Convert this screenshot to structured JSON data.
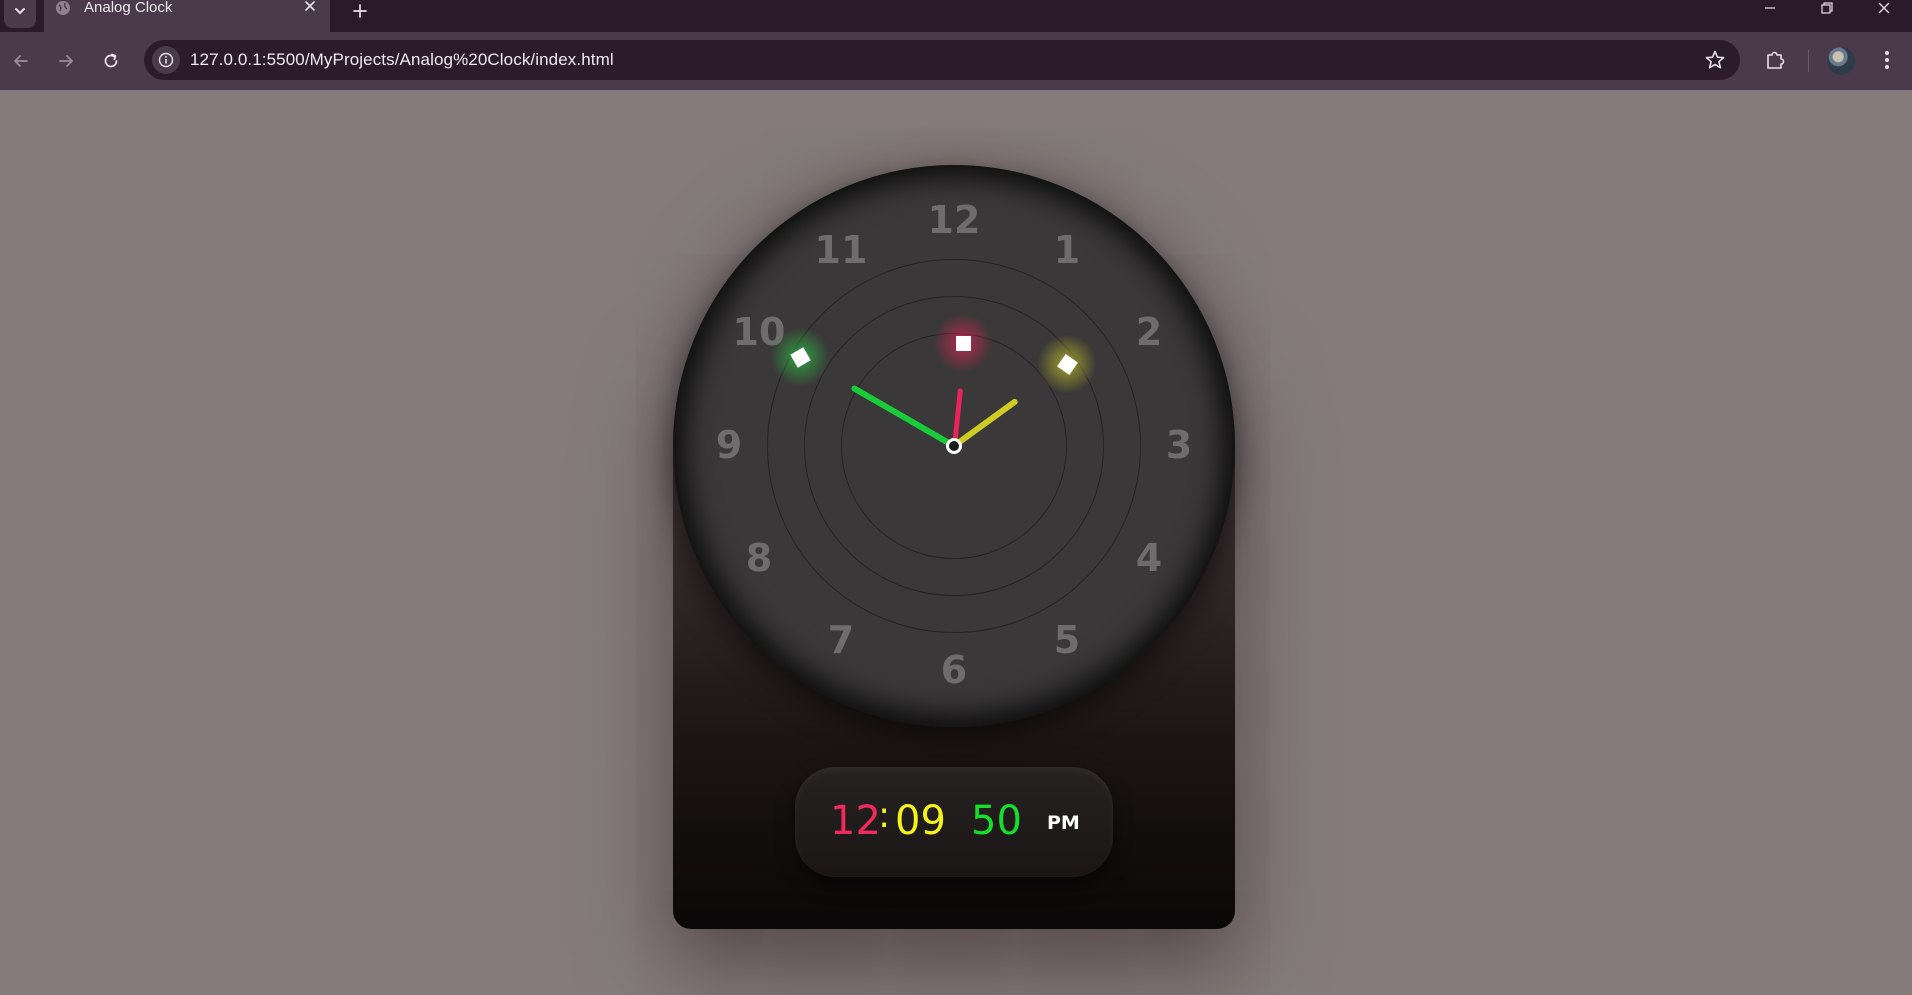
{
  "browser": {
    "tab_title": "Analog Clock",
    "url": "127.0.0.1:5500/MyProjects/Analog%20Clock/index.html",
    "icons": {
      "tab_menu": "chevron-down-icon",
      "favicon": "globe-icon",
      "tab_close": "close-icon",
      "new_tab": "plus-icon",
      "minimize": "minimize-icon",
      "restore": "restore-icon",
      "close_window": "close-icon",
      "back": "arrow-left-icon",
      "forward": "arrow-right-icon",
      "reload": "reload-icon",
      "site_info": "info-icon",
      "bookmark": "star-icon",
      "extensions": "puzzle-icon",
      "menu": "kebab-menu-icon"
    }
  },
  "clock": {
    "numbers": [
      "12",
      "1",
      "2",
      "3",
      "4",
      "5",
      "6",
      "7",
      "8",
      "9",
      "10",
      "11"
    ],
    "digital": {
      "hours": "12",
      "separator": ":",
      "minutes": "09",
      "seconds": "50",
      "ampm": "PM"
    },
    "colors": {
      "page_background": "#857b7b",
      "hour_hand": "#cfca24",
      "minute_hand": "#19cc3a",
      "second_hand": "#e8245a",
      "digital_hours": "#f2295f",
      "digital_minutes": "#f3f41a",
      "digital_seconds": "#14e02c"
    }
  }
}
